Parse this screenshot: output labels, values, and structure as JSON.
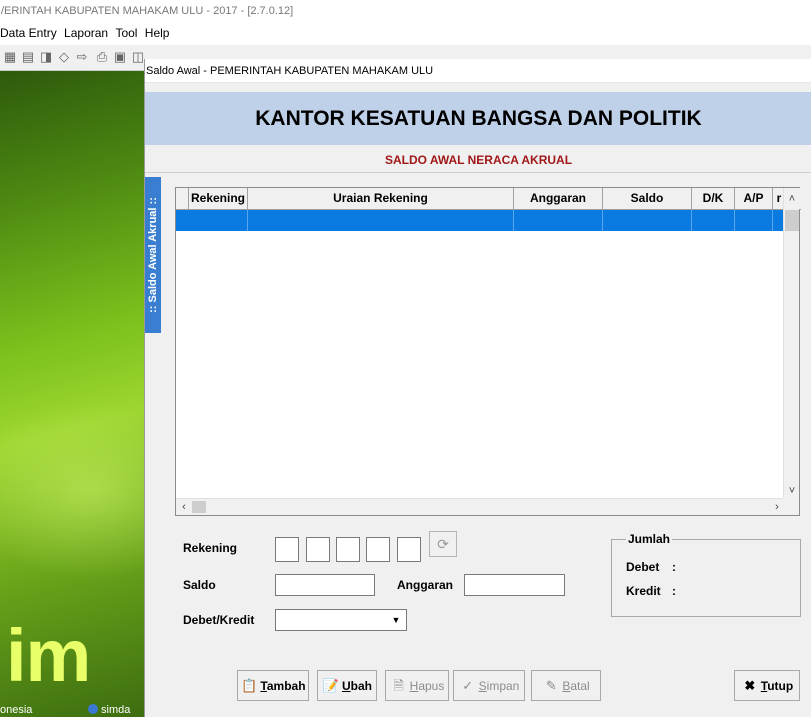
{
  "app": {
    "title": "/ERINTAH KABUPATEN MAHAKAM ULU - 2017 - [2.7.0.12]",
    "menu": [
      "Data Entry",
      "Laporan",
      "Tool",
      "Help"
    ]
  },
  "background": {
    "brand_fragment": "im",
    "footer_left": "onesia",
    "footer_right": "simda"
  },
  "dialog": {
    "title": "Saldo Awal - PEMERINTAH KABUPATEN MAHAKAM ULU",
    "org_name": "KANTOR KESATUAN BANGSA DAN POLITIK",
    "form_title": "SALDO AWAL NERACA AKRUAL",
    "side_tab": ":: Saldo Awal Akrual ::"
  },
  "grid": {
    "columns": [
      "Rekening",
      "Uraian Rekening",
      "Anggaran",
      "Saldo",
      "D/K",
      "A/P",
      "r"
    ],
    "rows": [
      [
        "",
        "",
        "",
        "",
        "",
        "",
        ""
      ]
    ]
  },
  "form": {
    "rekening_label": "Rekening",
    "saldo_label": "Saldo",
    "anggaran_label": "Anggaran",
    "debet_kredit_label": "Debet/Kredit",
    "saldo_value": "",
    "anggaran_value": "",
    "debet_kredit_value": ""
  },
  "jumlah": {
    "legend": "Jumlah",
    "debet_label": "Debet",
    "kredit_label": "Kredit",
    "debet_value": "",
    "kredit_value": ""
  },
  "buttons": {
    "tambah": {
      "hot": "T",
      "rest": "ambah"
    },
    "ubah": {
      "hot": "U",
      "rest": "bah"
    },
    "hapus": {
      "hot": "H",
      "rest": "apus"
    },
    "simpan": {
      "hot": "S",
      "rest": "impan"
    },
    "batal": {
      "hot": "B",
      "rest": "atal"
    },
    "tutup": {
      "hot": "T",
      "rest": "utup"
    }
  },
  "colors": {
    "header_band": "#bfd0e9",
    "form_title": "#a01818",
    "selection": "#0a7ae0",
    "side_tab": "#3a7ed1"
  }
}
